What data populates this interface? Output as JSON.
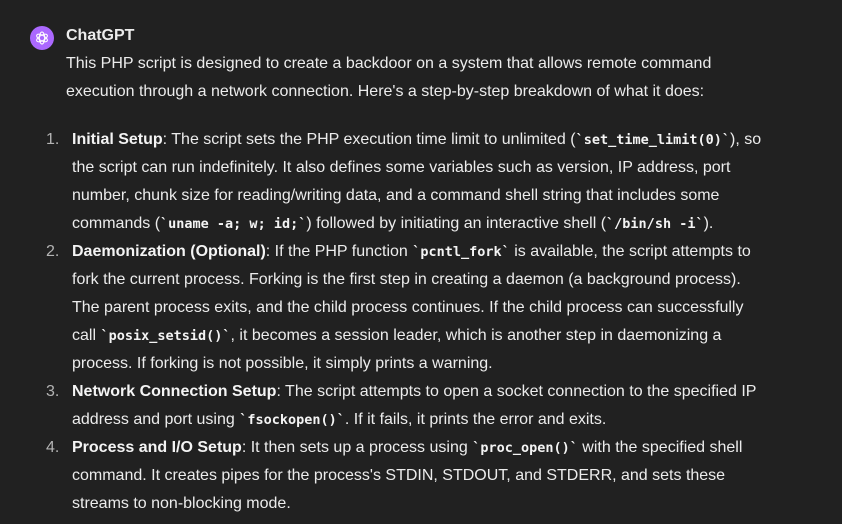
{
  "message": {
    "author": "ChatGPT",
    "avatar_icon": "openai-logo-icon",
    "avatar_color": "#ab68ff",
    "intro": "This PHP script is designed to create a backdoor on a system that allows remote command execution through a network connection. Here's a step-by-step breakdown of what it does:",
    "steps": [
      {
        "number": "1.",
        "title": "Initial Setup",
        "t1": ": The script sets the PHP execution time limit to unlimited (",
        "c1": "`set_time_limit(0)`",
        "t2": "), so the script can run indefinitely. It also defines some variables such as version, IP address, port number, chunk size for reading/writing data, and a command shell string that includes some commands (",
        "c2": "`uname -a; w; id;`",
        "t3": ") followed by initiating an interactive shell (",
        "c3": "`/bin/sh -i`",
        "t4": ")."
      },
      {
        "number": "2.",
        "title": "Daemonization (Optional)",
        "t1": ": If the PHP function ",
        "c1": "`pcntl_fork`",
        "t2": " is available, the script attempts to fork the current process. Forking is the first step in creating a daemon (a background process). The parent process exits, and the child process continues. If the child process can successfully call ",
        "c2": "`posix_setsid()`",
        "t3": ", it becomes a session leader, which is another step in daemonizing a process. If forking is not possible, it simply prints a warning."
      },
      {
        "number": "3.",
        "title": "Network Connection Setup",
        "t1": ": The script attempts to open a socket connection to the specified IP address and port using ",
        "c1": "`fsockopen()`",
        "t2": ". If it fails, it prints the error and exits."
      },
      {
        "number": "4.",
        "title": "Process and I/O Setup",
        "t1": ": It then sets up a process using ",
        "c1": "`proc_open()`",
        "t2": " with the specified shell command. It creates pipes for the process's STDIN, STDOUT, and STDERR, and sets these streams to non-blocking mode."
      }
    ]
  }
}
